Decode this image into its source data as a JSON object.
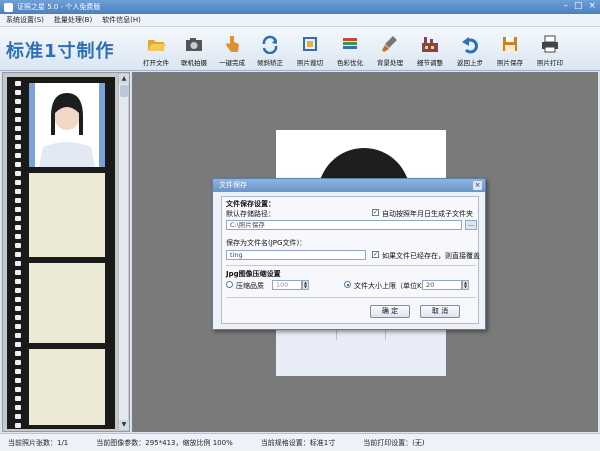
{
  "window": {
    "title": "证照之星 5.0 - 个人免费版"
  },
  "menu": [
    "系统设置(S)",
    "批量处理(B)",
    "软件信息(H)"
  ],
  "brand": "标准1寸制作",
  "toolbar": [
    {
      "label": "打开文件",
      "icon": "folder-open-icon",
      "color": "#e6a820"
    },
    {
      "label": "联机拍摄",
      "icon": "camera-icon",
      "color": "#555555"
    },
    {
      "label": "一键完成",
      "icon": "hand-pointer-icon",
      "color": "#e09030"
    },
    {
      "label": "倾斜矫正",
      "icon": "rotate-arrows-icon",
      "color": "#2f6fb7"
    },
    {
      "label": "照片裁切",
      "icon": "crop-icon",
      "color": "#2f6fb7"
    },
    {
      "label": "色彩优化",
      "icon": "color-bars-icon",
      "color": "#d04040"
    },
    {
      "label": "背景处理",
      "icon": "brush-icon",
      "color": "#c07020"
    },
    {
      "label": "细节调整",
      "icon": "factory-icon",
      "color": "#884444"
    },
    {
      "label": "返回上步",
      "icon": "undo-icon",
      "color": "#2f6fb7"
    },
    {
      "label": "照片保存",
      "icon": "save-disk-icon",
      "color": "#d08020"
    },
    {
      "label": "照片打印",
      "icon": "printer-icon",
      "color": "#444444"
    }
  ],
  "dialog": {
    "title": "文件保存",
    "section_save": "文件保存设置：",
    "default_path_label": "默认存储路径：",
    "auto_folder_label": "自动按照年月日生成子文件夹",
    "path_value": "C:\\照片保存",
    "browse_label": "...",
    "filename_label": "保存为文件名(JPG文件)：",
    "overwrite_label": "如果文件已经存在，则直接覆盖",
    "filename_value": "ting",
    "section_jpg": "Jpg图像压缩设置",
    "quality_label": "压缩品质",
    "quality_value": "100",
    "size_label": "文件大小上限（单位K）",
    "size_value": "20",
    "ok_label": "确 定",
    "cancel_label": "取 消",
    "auto_folder_checked": true,
    "overwrite_checked": true,
    "size_selected": true
  },
  "status": {
    "count": "当前照片张数：1/1",
    "image_info": "当前图像参数：295*413，缩放比例 100%",
    "template": "当前规格设置：标准1寸",
    "print": "当前打印设置：(无)"
  }
}
